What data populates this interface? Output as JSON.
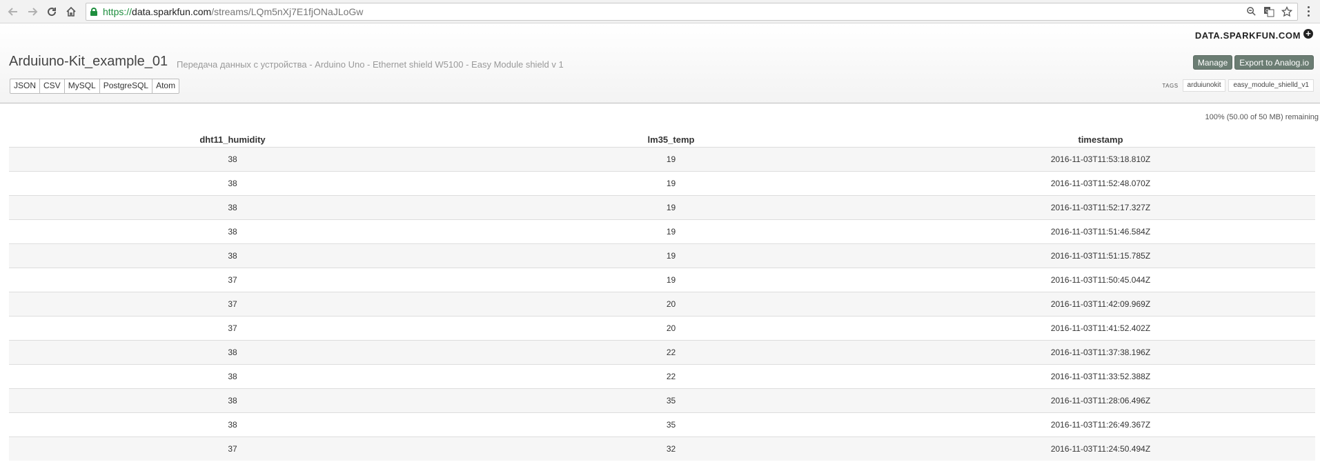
{
  "browser": {
    "url_scheme": "https://",
    "url_host": "data.sparkfun.com",
    "url_path": "/streams/LQm5nXj7E1fjONaJLoGw"
  },
  "header": {
    "brand": "DATA.SPARKFUN.COM",
    "title": "Arduiuno-Kit_example_01",
    "description": "Передача данных с устройства - Arduino Uno - Ethernet shield W5100 - Easy Module shield v 1",
    "manage_label": "Manage",
    "export_label": "Export to Analog.io",
    "format_tabs": [
      "JSON",
      "CSV",
      "MySQL",
      "PostgreSQL",
      "Atom"
    ],
    "tags_label": "TAGS",
    "tags": [
      "arduiunokit",
      "easy_module_shielld_v1"
    ]
  },
  "main": {
    "remaining": "100% (50.00 of 50 MB) remaining",
    "columns": [
      "dht11_humidity",
      "lm35_temp",
      "timestamp"
    ],
    "rows": [
      [
        "38",
        "19",
        "2016-11-03T11:53:18.810Z"
      ],
      [
        "38",
        "19",
        "2016-11-03T11:52:48.070Z"
      ],
      [
        "38",
        "19",
        "2016-11-03T11:52:17.327Z"
      ],
      [
        "38",
        "19",
        "2016-11-03T11:51:46.584Z"
      ],
      [
        "38",
        "19",
        "2016-11-03T11:51:15.785Z"
      ],
      [
        "37",
        "19",
        "2016-11-03T11:50:45.044Z"
      ],
      [
        "37",
        "20",
        "2016-11-03T11:42:09.969Z"
      ],
      [
        "37",
        "20",
        "2016-11-03T11:41:52.402Z"
      ],
      [
        "38",
        "22",
        "2016-11-03T11:37:38.196Z"
      ],
      [
        "38",
        "22",
        "2016-11-03T11:33:52.388Z"
      ],
      [
        "38",
        "35",
        "2016-11-03T11:28:06.496Z"
      ],
      [
        "38",
        "35",
        "2016-11-03T11:26:49.367Z"
      ],
      [
        "37",
        "32",
        "2016-11-03T11:24:50.494Z"
      ]
    ]
  }
}
